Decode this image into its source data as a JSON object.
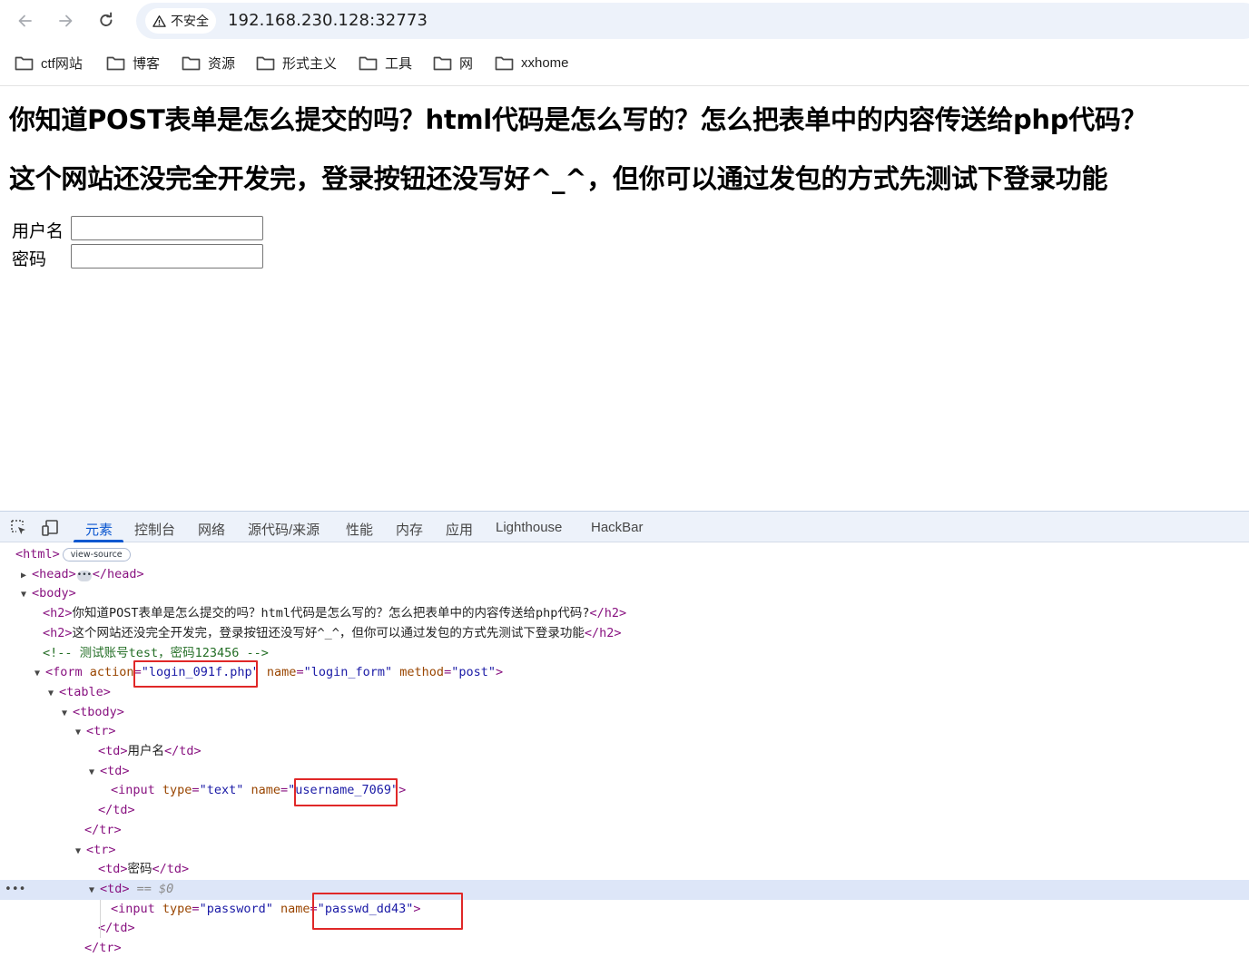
{
  "browser": {
    "security_label": "不安全",
    "url": "192.168.230.128:32773"
  },
  "bookmarks": [
    {
      "label": "ctf网站"
    },
    {
      "label": "博客"
    },
    {
      "label": "资源"
    },
    {
      "label": "形式主义"
    },
    {
      "label": "工具"
    },
    {
      "label": "网"
    },
    {
      "label": "xxhome"
    }
  ],
  "page": {
    "heading1": "你知道POST表单是怎么提交的吗？html代码是怎么写的？怎么把表单中的内容传送给php代码？",
    "heading2": "这个网站还没完全开发完，登录按钮还没写好^_^，但你可以通过发包的方式先测试下登录功能",
    "username_label": "用户名",
    "password_label": "密码",
    "username_value": "",
    "password_value": ""
  },
  "devtools": {
    "tabs": [
      "元素",
      "控制台",
      "网络",
      "源代码/来源",
      "性能",
      "内存",
      "应用",
      "Lighthouse",
      "HackBar"
    ],
    "active_tab": "元素",
    "view_source_badge": "view-source",
    "dom": {
      "html_open": "<html>",
      "head": "<head>",
      "head_close": "</head>",
      "body": "<body>",
      "h2_1_text": "你知道POST表单是怎么提交的吗？html代码是怎么写的？怎么把表单中的内容传送给php代码?",
      "h2_2_text": "这个网站还没完全开发完，登录按钮还没写好^_^，但你可以通过发包的方式先测试下登录功能",
      "comment": "<!-- 测试账号test，密码123456 -->",
      "form_action": "login_091f.php",
      "form_name": "login_form",
      "form_method": "post",
      "td_username": "用户名",
      "input1_type": "text",
      "input1_name": "username_7069",
      "td_password": "密码",
      "selected_marker": "== $0",
      "input2_type": "password",
      "input2_name": "passwd_dd43"
    }
  }
}
